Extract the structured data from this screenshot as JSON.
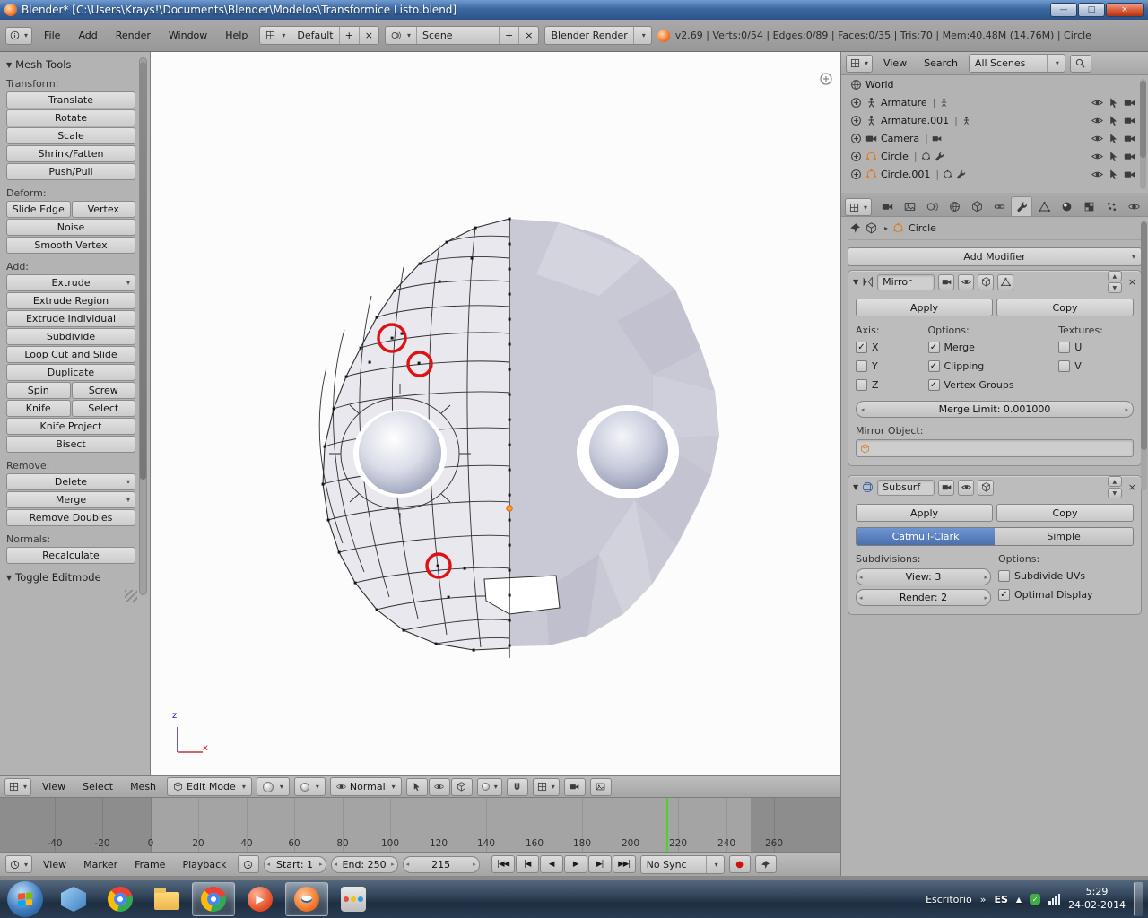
{
  "colors": {
    "accent": "#4a70ad",
    "playhead": "#49d32b",
    "annotation": "#de1212"
  },
  "glyphs": {
    "panel_open": "▼",
    "dropdown": "▾",
    "close": "×",
    "minimize": "—",
    "maximize": "□",
    "chevron_right": "»",
    "caret_up": "▲",
    "record": "●",
    "check": "✓",
    "pipe": "|"
  },
  "titlebar": {
    "title": "Blender* [C:\\Users\\Krays!\\Documents\\Blender\\Modelos\\Transformice Listo.blend]"
  },
  "header": {
    "menus": [
      "File",
      "Add",
      "Render",
      "Window",
      "Help"
    ],
    "layout": "Default",
    "scene": "Scene",
    "engine": "Blender Render",
    "stats": "v2.69 | Verts:0/54 | Edges:0/89 | Faces:0/35 | Tris:70 | Mem:40.48M (14.76M) | Circle"
  },
  "toolshelf": {
    "title": "Mesh Tools",
    "transform_label": "Transform:",
    "transform": [
      "Translate",
      "Rotate",
      "Scale",
      "Shrink/Fatten",
      "Push/Pull"
    ],
    "deform_label": "Deform:",
    "deform_pair": [
      "Slide Edge",
      "Vertex"
    ],
    "deform": [
      "Noise",
      "Smooth Vertex"
    ],
    "add_label": "Add:",
    "extrude_menu": "Extrude",
    "add": [
      "Extrude Region",
      "Extrude Individual",
      "Subdivide",
      "Loop Cut and Slide",
      "Duplicate"
    ],
    "pair1": [
      "Spin",
      "Screw"
    ],
    "pair2": [
      "Knife",
      "Select"
    ],
    "add2": [
      "Knife Project",
      "Bisect"
    ],
    "remove_label": "Remove:",
    "delete_menu": "Delete",
    "merge_menu": "Merge",
    "remove_doubles": "Remove Doubles",
    "normals_label": "Normals:",
    "recalculate": "Recalculate",
    "toggle_panel": "Toggle Editmode"
  },
  "viewport": {
    "axis_x": "x",
    "axis_z": "z"
  },
  "view3d_header": {
    "menus": [
      "View",
      "Select",
      "Mesh"
    ],
    "mode": "Edit Mode",
    "orientation": "Normal"
  },
  "outliner": {
    "menus": [
      "View",
      "Search"
    ],
    "scope": "All Scenes",
    "items": [
      {
        "name": "World"
      },
      {
        "name": "Armature"
      },
      {
        "name": "Armature.001"
      },
      {
        "name": "Camera"
      },
      {
        "name": "Circle"
      },
      {
        "name": "Circle.001"
      }
    ]
  },
  "properties": {
    "context_name": "Circle",
    "add_modifier": "Add Modifier",
    "mirror": {
      "name": "Mirror",
      "apply": "Apply",
      "copy": "Copy",
      "axis_label": "Axis:",
      "options_label": "Options:",
      "textures_label": "Textures:",
      "axis": [
        {
          "label": "X",
          "checked": true
        },
        {
          "label": "Y",
          "checked": false
        },
        {
          "label": "Z",
          "checked": false
        }
      ],
      "options": [
        {
          "label": "Merge",
          "checked": true
        },
        {
          "label": "Clipping",
          "checked": true
        },
        {
          "label": "Vertex Groups",
          "checked": true
        }
      ],
      "textures": [
        {
          "label": "U",
          "checked": false
        },
        {
          "label": "V",
          "checked": false
        }
      ],
      "merge_limit": "Merge Limit: 0.001000",
      "mirror_object_label": "Mirror Object:"
    },
    "subsurf": {
      "name": "Subsurf",
      "apply": "Apply",
      "copy": "Copy",
      "type_active": "Catmull-Clark",
      "type_inactive": "Simple",
      "subdivisions_label": "Subdivisions:",
      "options_label": "Options:",
      "view": "View: 3",
      "render": "Render: 2",
      "options": [
        {
          "label": "Subdivide UVs",
          "checked": false
        },
        {
          "label": "Optimal Display",
          "checked": true
        }
      ]
    }
  },
  "timeline": {
    "menus": [
      "View",
      "Marker",
      "Frame",
      "Playback"
    ],
    "start": "Start: 1",
    "end": "End: 250",
    "frame": "215",
    "sync": "No Sync",
    "current_frame": 215,
    "ticks": [
      "-40",
      "-20",
      "0",
      "20",
      "40",
      "60",
      "80",
      "100",
      "120",
      "140",
      "160",
      "180",
      "200",
      "220",
      "240",
      "260"
    ],
    "transport": [
      "|◀◀",
      "|◀",
      "◀",
      "▶",
      "▶|",
      "▶▶|"
    ]
  },
  "taskbar": {
    "tray_desktop": "Escritorio",
    "tray_lang": "ES",
    "time": "5:29",
    "date": "24-02-2014"
  }
}
